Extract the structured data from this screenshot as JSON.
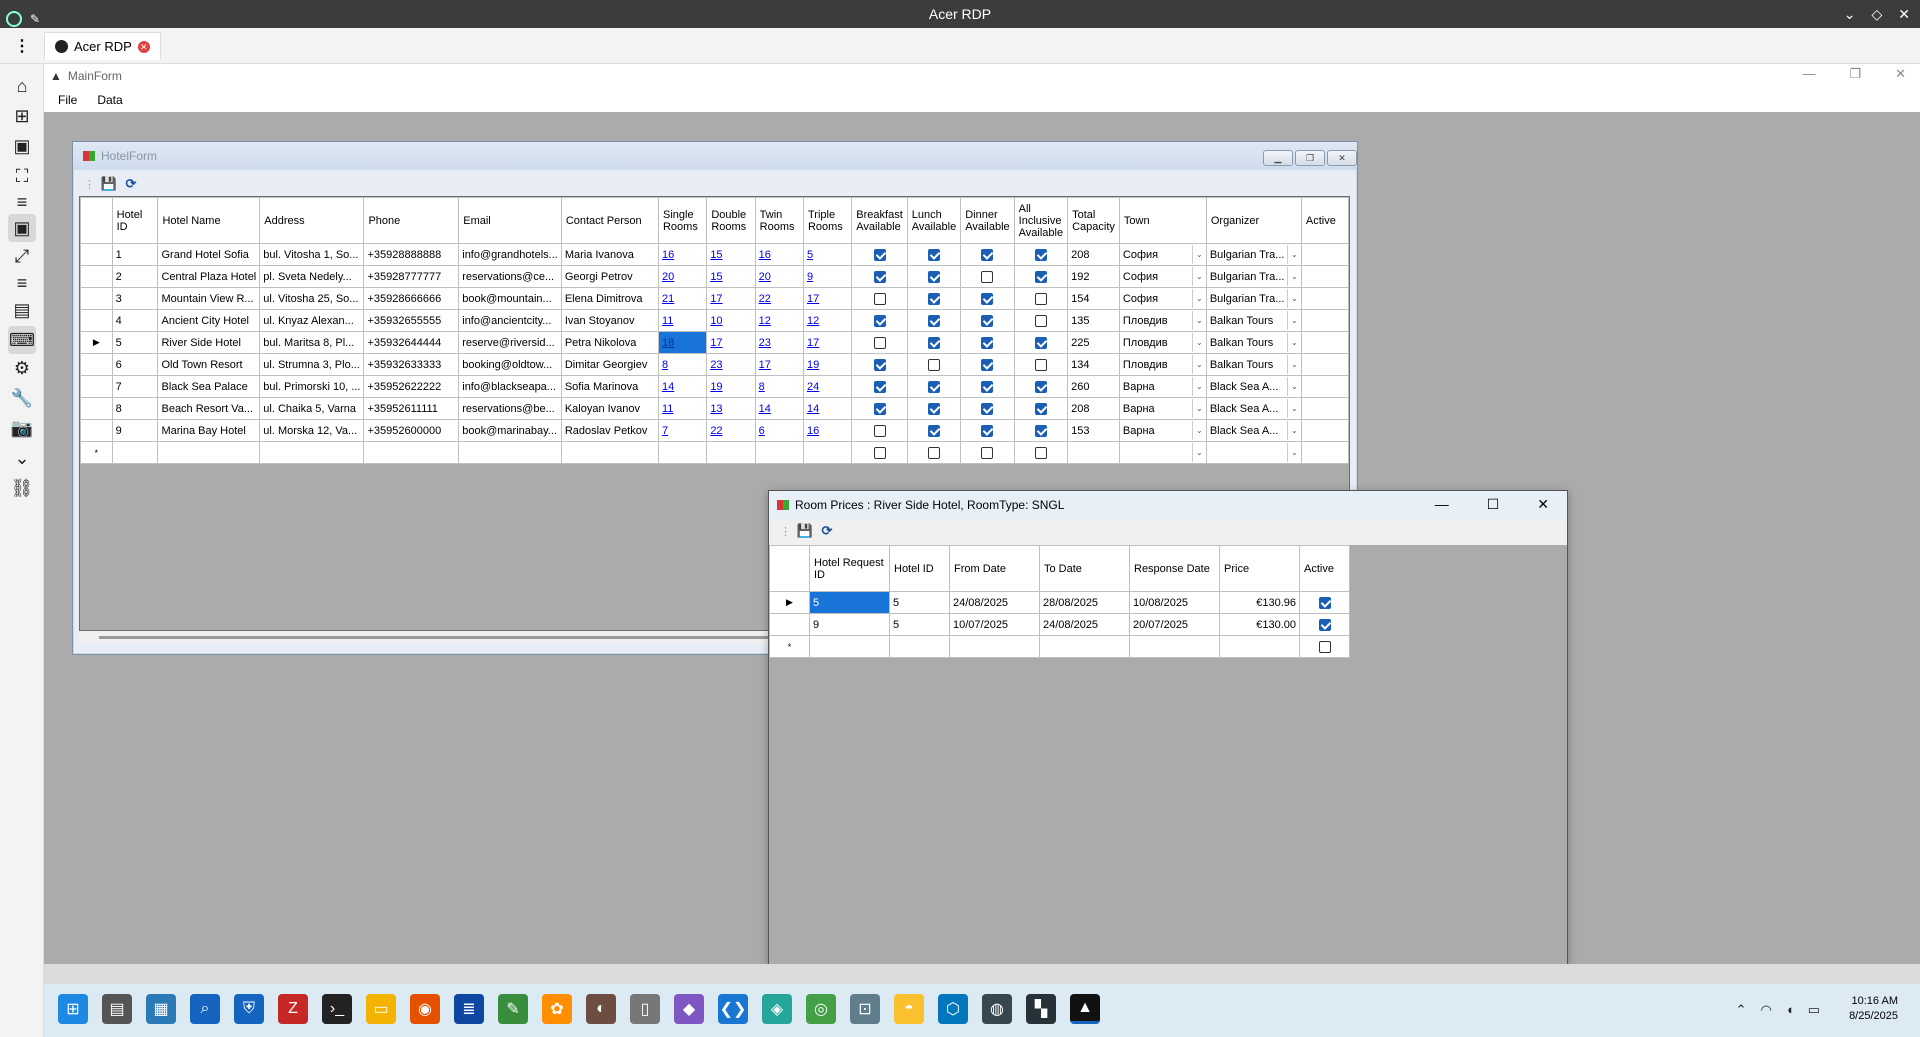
{
  "rdp": {
    "title": "Acer RDP",
    "tab_label": "Acer RDP"
  },
  "mainform": {
    "title": "MainForm",
    "menu": [
      "File",
      "Data"
    ]
  },
  "hotelform": {
    "title": "HotelForm",
    "columns": [
      "Hotel ID",
      "Hotel Name",
      "Address",
      "Phone",
      "Email",
      "Contact Person",
      "Single Rooms",
      "Double Rooms",
      "Twin Rooms",
      "Triple Rooms",
      "Breakfast Available",
      "Lunch Available",
      "Dinner Available",
      "All Inclusive Available",
      "Total Capacity",
      "Town",
      "Organizer",
      "Active"
    ],
    "rows": [
      {
        "id": "1",
        "name": "Grand Hotel Sofia",
        "address": "bul. Vitosha 1, So...",
        "phone": "+35928888888",
        "email": "info@grandhotels...",
        "contact": "Maria Ivanova",
        "single": "16",
        "double": "15",
        "twin": "16",
        "triple": "5",
        "breakfast": true,
        "lunch": true,
        "dinner": true,
        "all_inclusive": true,
        "capacity": "208",
        "town": "София",
        "organizer": "Bulgarian Tra..."
      },
      {
        "id": "2",
        "name": "Central Plaza Hotel",
        "address": "pl. Sveta Nedely...",
        "phone": "+35928777777",
        "email": "reservations@ce...",
        "contact": "Georgi Petrov",
        "single": "20",
        "double": "15",
        "twin": "20",
        "triple": "9",
        "breakfast": true,
        "lunch": true,
        "dinner": false,
        "all_inclusive": true,
        "capacity": "192",
        "town": "София",
        "organizer": "Bulgarian Tra..."
      },
      {
        "id": "3",
        "name": "Mountain View R...",
        "address": "ul. Vitosha 25, So...",
        "phone": "+35928666666",
        "email": "book@mountain...",
        "contact": "Elena Dimitrova",
        "single": "21",
        "double": "17",
        "twin": "22",
        "triple": "17",
        "breakfast": false,
        "lunch": true,
        "dinner": true,
        "all_inclusive": false,
        "capacity": "154",
        "town": "София",
        "organizer": "Bulgarian Tra..."
      },
      {
        "id": "4",
        "name": "Ancient City Hotel",
        "address": "ul. Knyaz Alexan...",
        "phone": "+35932655555",
        "email": "info@ancientcity...",
        "contact": "Ivan Stoyanov",
        "single": "11",
        "double": "10",
        "twin": "12",
        "triple": "12",
        "breakfast": true,
        "lunch": true,
        "dinner": true,
        "all_inclusive": false,
        "capacity": "135",
        "town": "Пловдив",
        "organizer": "Balkan Tours"
      },
      {
        "id": "5",
        "name": "River Side Hotel",
        "address": "bul. Maritsa 8, Pl...",
        "phone": "+35932644444",
        "email": "reserve@riversid...",
        "contact": "Petra Nikolova",
        "single": "18",
        "double": "17",
        "twin": "23",
        "triple": "17",
        "breakfast": false,
        "lunch": true,
        "dinner": true,
        "all_inclusive": true,
        "capacity": "225",
        "town": "Пловдив",
        "organizer": "Balkan Tours",
        "current": true
      },
      {
        "id": "6",
        "name": "Old Town Resort",
        "address": "ul. Strumna 3, Plo...",
        "phone": "+35932633333",
        "email": "booking@oldtow...",
        "contact": "Dimitar Georgiev",
        "single": "8",
        "double": "23",
        "twin": "17",
        "triple": "19",
        "breakfast": true,
        "lunch": false,
        "dinner": true,
        "all_inclusive": false,
        "capacity": "134",
        "town": "Пловдив",
        "organizer": "Balkan Tours"
      },
      {
        "id": "7",
        "name": "Black Sea Palace",
        "address": "bul. Primorski 10, ...",
        "phone": "+35952622222",
        "email": "info@blackseapa...",
        "contact": "Sofia Marinova",
        "single": "14",
        "double": "19",
        "twin": "8",
        "triple": "24",
        "breakfast": true,
        "lunch": true,
        "dinner": true,
        "all_inclusive": true,
        "capacity": "260",
        "town": "Варна",
        "organizer": "Black Sea A..."
      },
      {
        "id": "8",
        "name": "Beach Resort Va...",
        "address": "ul. Chaika 5, Varna",
        "phone": "+35952611111",
        "email": "reservations@be...",
        "contact": "Kaloyan Ivanov",
        "single": "11",
        "double": "13",
        "twin": "14",
        "triple": "14",
        "breakfast": true,
        "lunch": true,
        "dinner": true,
        "all_inclusive": true,
        "capacity": "208",
        "town": "Варна",
        "organizer": "Black Sea A..."
      },
      {
        "id": "9",
        "name": "Marina Bay Hotel",
        "address": "ul. Morska 12, Va...",
        "phone": "+35952600000",
        "email": "book@marinabay...",
        "contact": "Radoslav Petkov",
        "single": "7",
        "double": "22",
        "twin": "6",
        "triple": "16",
        "breakfast": false,
        "lunch": true,
        "dinner": true,
        "all_inclusive": true,
        "capacity": "153",
        "town": "Варна",
        "organizer": "Black Sea A..."
      }
    ]
  },
  "roomprices": {
    "title": "Room Prices : River Side Hotel, RoomType: SNGL",
    "columns": [
      "Hotel Request ID",
      "Hotel ID",
      "From Date",
      "To Date",
      "Response Date",
      "Price",
      "Active"
    ],
    "rows": [
      {
        "request_id": "5",
        "hotel_id": "5",
        "from": "24/08/2025",
        "to": "28/08/2025",
        "response": "10/08/2025",
        "price": "€130.96",
        "active": true,
        "current": true
      },
      {
        "request_id": "9",
        "hotel_id": "5",
        "from": "10/07/2025",
        "to": "24/08/2025",
        "response": "20/07/2025",
        "price": "€130.00",
        "active": true
      }
    ]
  },
  "taskbar": {
    "time": "10:16 AM",
    "date": "8/25/2025"
  },
  "colors": {
    "selection": "#1874d8",
    "checkbox": "#1a5fb4",
    "mdi_background": "#ababab"
  }
}
